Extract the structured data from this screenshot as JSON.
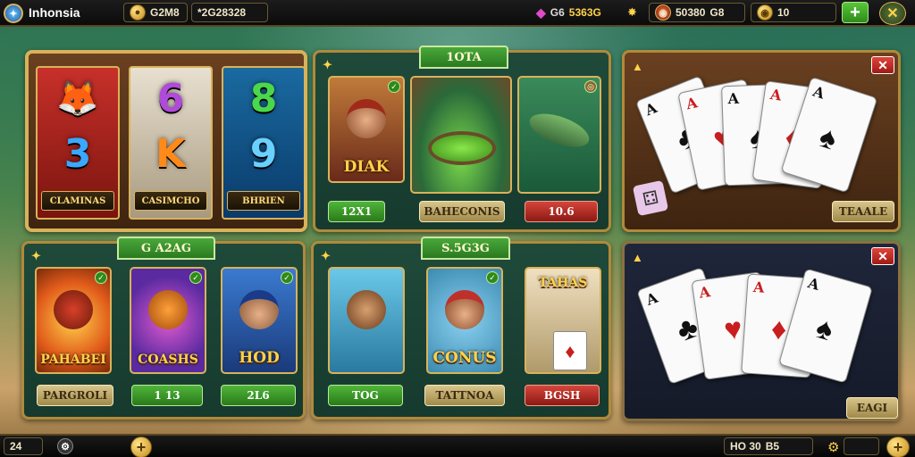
{
  "topbar": {
    "title": "Inhonsia",
    "field_a": "G2M8",
    "field_b": "*2G28328",
    "gem_count": "5363G",
    "coins_label": "50380",
    "coins_suffix": "G8",
    "gold_value": "10"
  },
  "slot_panel": {
    "reels": [
      {
        "symbol": "3",
        "label": "CLAMINAS",
        "color": "#3aa8ff"
      },
      {
        "symbol": "K",
        "label": "CASIMCHO",
        "color": "#ff8a1a"
      },
      {
        "symbol": "9",
        "label": "BHRIEN",
        "color": "#6ad0ff"
      }
    ],
    "top_symbols": [
      "🦊",
      "6",
      "8"
    ]
  },
  "adventure_panel": {
    "tab": "1OTA",
    "cards": [
      {
        "title": "DIAK",
        "button": "12X1",
        "style": "green"
      },
      {
        "title": "",
        "button": "BAHECONIS",
        "style": "tan"
      },
      {
        "title": "",
        "button": "10.6",
        "style": "red"
      }
    ]
  },
  "character_panel": {
    "tab": "G A2AG",
    "cards": [
      {
        "title": "PAHABEI",
        "button": "PARGROLI",
        "style": "tan"
      },
      {
        "title": "COASHS",
        "button": "1 13",
        "style": "green"
      },
      {
        "title": "HOD",
        "button": "2L6",
        "style": "green"
      }
    ]
  },
  "bonus_panel": {
    "tab": "S.5G3G",
    "cards": [
      {
        "title": "",
        "button": "TOG",
        "style": "green"
      },
      {
        "title": "CONUS",
        "button": "TATTNOA",
        "style": "tan"
      },
      {
        "title": "TAHAS",
        "button": "BGSH",
        "style": "red"
      }
    ]
  },
  "cards_top": {
    "button": "TEAALE",
    "cards": [
      {
        "rank": "A",
        "suit": "♣",
        "red": false
      },
      {
        "rank": "A",
        "suit": "♥",
        "red": true
      },
      {
        "rank": "A",
        "suit": "♠",
        "red": false
      },
      {
        "rank": "A",
        "suit": "♦",
        "red": true
      },
      {
        "rank": "A",
        "suit": "♠",
        "red": false
      }
    ]
  },
  "cards_bottom": {
    "button": "EAGI",
    "cards": [
      {
        "rank": "A",
        "suit": "♣",
        "red": false
      },
      {
        "rank": "A",
        "suit": "♥",
        "red": true
      },
      {
        "rank": "A",
        "suit": "♦",
        "red": true
      },
      {
        "rank": "A",
        "suit": "♠",
        "red": false
      }
    ]
  },
  "bottombar": {
    "level": "24",
    "win_label": "HO 30",
    "win_suffix": "B5"
  },
  "colors": {
    "accent": "#4fb53a",
    "gold": "#d9b25a",
    "close": "#e0443a"
  }
}
